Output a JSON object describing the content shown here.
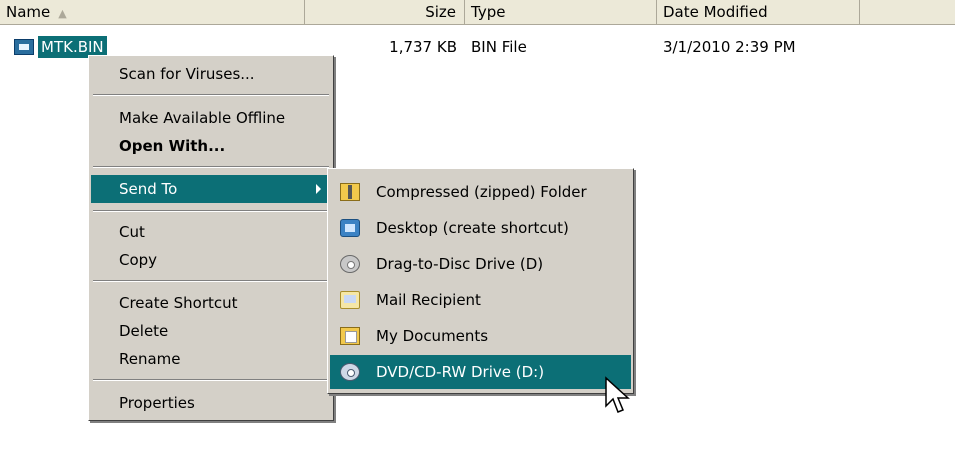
{
  "columns": {
    "name": "Name",
    "size": "Size",
    "type": "Type",
    "date": "Date Modified",
    "sort_icon": "sort-ascending-icon"
  },
  "file": {
    "name": "MTK.BIN",
    "size": "1,737 KB",
    "type": "BIN File",
    "date": "3/1/2010 2:39 PM",
    "icon": "bin-file-icon"
  },
  "context_menu": {
    "scan": "Scan for Viruses...",
    "offline": "Make Available Offline",
    "open_with": "Open With...",
    "send_to": "Send To",
    "cut": "Cut",
    "copy": "Copy",
    "create_shortcut": "Create Shortcut",
    "delete": "Delete",
    "rename": "Rename",
    "properties": "Properties"
  },
  "send_to_menu": {
    "items": [
      {
        "label": "Compressed (zipped) Folder",
        "icon": "zip-folder-icon"
      },
      {
        "label": "Desktop (create shortcut)",
        "icon": "desktop-icon"
      },
      {
        "label": "Drag-to-Disc Drive (D)",
        "icon": "disc-drive-icon"
      },
      {
        "label": "Mail Recipient",
        "icon": "mail-icon"
      },
      {
        "label": "My Documents",
        "icon": "documents-folder-icon"
      },
      {
        "label": "DVD/CD-RW Drive (D:)",
        "icon": "dvd-drive-icon"
      }
    ],
    "highlighted": "DVD/CD-RW Drive (D:)"
  },
  "colors": {
    "highlight": "#0c6f76",
    "menu_bg": "#d4d0c8",
    "header_bg": "#ece9d8"
  }
}
